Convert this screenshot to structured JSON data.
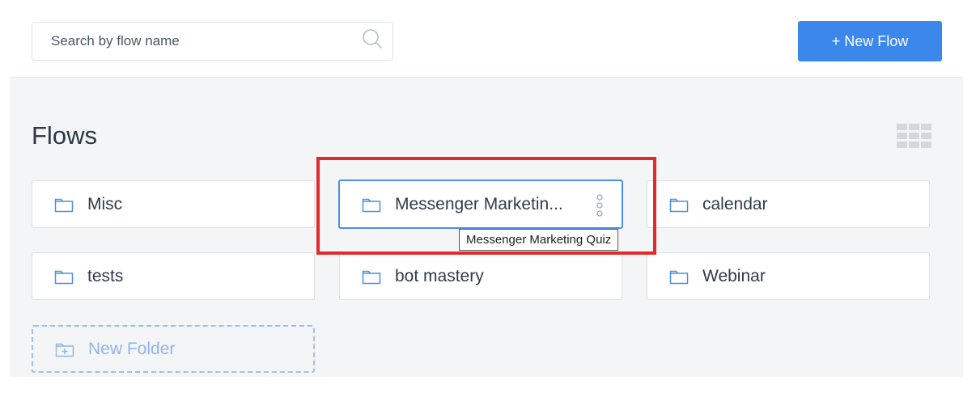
{
  "search": {
    "placeholder": "Search by flow name"
  },
  "toolbar": {
    "new_flow_label": "+ New Flow"
  },
  "page": {
    "title": "Flows"
  },
  "folders": [
    {
      "label": "Misc",
      "icon": "folder-icon"
    },
    {
      "label": "Messenger Marketin...",
      "icon": "folder-icon",
      "tooltip": "Messenger Marketing Quiz"
    },
    {
      "label": "calendar",
      "icon": "folder-icon"
    },
    {
      "label": "tests",
      "icon": "folder-icon"
    },
    {
      "label": "bot mastery",
      "icon": "folder-icon"
    },
    {
      "label": "Webinar",
      "icon": "folder-icon"
    }
  ],
  "new_folder": {
    "label": "New Folder",
    "icon": "folder-plus-icon"
  },
  "colors": {
    "accent": "#3b87ec",
    "folder_icon": "#4a90e2",
    "highlight": "#e12b2b",
    "background": "#f4f5f7"
  }
}
